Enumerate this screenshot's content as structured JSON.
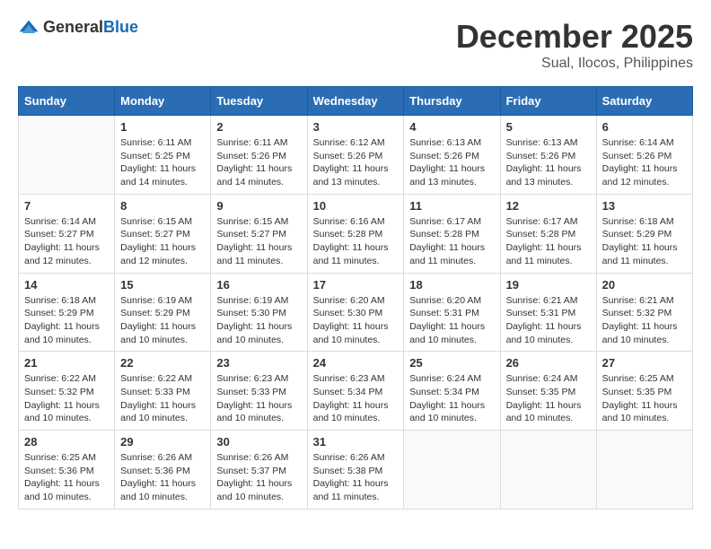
{
  "logo": {
    "general": "General",
    "blue": "Blue"
  },
  "title": "December 2025",
  "location": "Sual, Ilocos, Philippines",
  "weekdays": [
    "Sunday",
    "Monday",
    "Tuesday",
    "Wednesday",
    "Thursday",
    "Friday",
    "Saturday"
  ],
  "weeks": [
    [
      {
        "day": "",
        "empty": true
      },
      {
        "day": "1",
        "sunrise": "Sunrise: 6:11 AM",
        "sunset": "Sunset: 5:25 PM",
        "daylight": "Daylight: 11 hours and 14 minutes."
      },
      {
        "day": "2",
        "sunrise": "Sunrise: 6:11 AM",
        "sunset": "Sunset: 5:26 PM",
        "daylight": "Daylight: 11 hours and 14 minutes."
      },
      {
        "day": "3",
        "sunrise": "Sunrise: 6:12 AM",
        "sunset": "Sunset: 5:26 PM",
        "daylight": "Daylight: 11 hours and 13 minutes."
      },
      {
        "day": "4",
        "sunrise": "Sunrise: 6:13 AM",
        "sunset": "Sunset: 5:26 PM",
        "daylight": "Daylight: 11 hours and 13 minutes."
      },
      {
        "day": "5",
        "sunrise": "Sunrise: 6:13 AM",
        "sunset": "Sunset: 5:26 PM",
        "daylight": "Daylight: 11 hours and 13 minutes."
      },
      {
        "day": "6",
        "sunrise": "Sunrise: 6:14 AM",
        "sunset": "Sunset: 5:26 PM",
        "daylight": "Daylight: 11 hours and 12 minutes."
      }
    ],
    [
      {
        "day": "7",
        "sunrise": "Sunrise: 6:14 AM",
        "sunset": "Sunset: 5:27 PM",
        "daylight": "Daylight: 11 hours and 12 minutes."
      },
      {
        "day": "8",
        "sunrise": "Sunrise: 6:15 AM",
        "sunset": "Sunset: 5:27 PM",
        "daylight": "Daylight: 11 hours and 12 minutes."
      },
      {
        "day": "9",
        "sunrise": "Sunrise: 6:15 AM",
        "sunset": "Sunset: 5:27 PM",
        "daylight": "Daylight: 11 hours and 11 minutes."
      },
      {
        "day": "10",
        "sunrise": "Sunrise: 6:16 AM",
        "sunset": "Sunset: 5:28 PM",
        "daylight": "Daylight: 11 hours and 11 minutes."
      },
      {
        "day": "11",
        "sunrise": "Sunrise: 6:17 AM",
        "sunset": "Sunset: 5:28 PM",
        "daylight": "Daylight: 11 hours and 11 minutes."
      },
      {
        "day": "12",
        "sunrise": "Sunrise: 6:17 AM",
        "sunset": "Sunset: 5:28 PM",
        "daylight": "Daylight: 11 hours and 11 minutes."
      },
      {
        "day": "13",
        "sunrise": "Sunrise: 6:18 AM",
        "sunset": "Sunset: 5:29 PM",
        "daylight": "Daylight: 11 hours and 11 minutes."
      }
    ],
    [
      {
        "day": "14",
        "sunrise": "Sunrise: 6:18 AM",
        "sunset": "Sunset: 5:29 PM",
        "daylight": "Daylight: 11 hours and 10 minutes."
      },
      {
        "day": "15",
        "sunrise": "Sunrise: 6:19 AM",
        "sunset": "Sunset: 5:29 PM",
        "daylight": "Daylight: 11 hours and 10 minutes."
      },
      {
        "day": "16",
        "sunrise": "Sunrise: 6:19 AM",
        "sunset": "Sunset: 5:30 PM",
        "daylight": "Daylight: 11 hours and 10 minutes."
      },
      {
        "day": "17",
        "sunrise": "Sunrise: 6:20 AM",
        "sunset": "Sunset: 5:30 PM",
        "daylight": "Daylight: 11 hours and 10 minutes."
      },
      {
        "day": "18",
        "sunrise": "Sunrise: 6:20 AM",
        "sunset": "Sunset: 5:31 PM",
        "daylight": "Daylight: 11 hours and 10 minutes."
      },
      {
        "day": "19",
        "sunrise": "Sunrise: 6:21 AM",
        "sunset": "Sunset: 5:31 PM",
        "daylight": "Daylight: 11 hours and 10 minutes."
      },
      {
        "day": "20",
        "sunrise": "Sunrise: 6:21 AM",
        "sunset": "Sunset: 5:32 PM",
        "daylight": "Daylight: 11 hours and 10 minutes."
      }
    ],
    [
      {
        "day": "21",
        "sunrise": "Sunrise: 6:22 AM",
        "sunset": "Sunset: 5:32 PM",
        "daylight": "Daylight: 11 hours and 10 minutes."
      },
      {
        "day": "22",
        "sunrise": "Sunrise: 6:22 AM",
        "sunset": "Sunset: 5:33 PM",
        "daylight": "Daylight: 11 hours and 10 minutes."
      },
      {
        "day": "23",
        "sunrise": "Sunrise: 6:23 AM",
        "sunset": "Sunset: 5:33 PM",
        "daylight": "Daylight: 11 hours and 10 minutes."
      },
      {
        "day": "24",
        "sunrise": "Sunrise: 6:23 AM",
        "sunset": "Sunset: 5:34 PM",
        "daylight": "Daylight: 11 hours and 10 minutes."
      },
      {
        "day": "25",
        "sunrise": "Sunrise: 6:24 AM",
        "sunset": "Sunset: 5:34 PM",
        "daylight": "Daylight: 11 hours and 10 minutes."
      },
      {
        "day": "26",
        "sunrise": "Sunrise: 6:24 AM",
        "sunset": "Sunset: 5:35 PM",
        "daylight": "Daylight: 11 hours and 10 minutes."
      },
      {
        "day": "27",
        "sunrise": "Sunrise: 6:25 AM",
        "sunset": "Sunset: 5:35 PM",
        "daylight": "Daylight: 11 hours and 10 minutes."
      }
    ],
    [
      {
        "day": "28",
        "sunrise": "Sunrise: 6:25 AM",
        "sunset": "Sunset: 5:36 PM",
        "daylight": "Daylight: 11 hours and 10 minutes."
      },
      {
        "day": "29",
        "sunrise": "Sunrise: 6:26 AM",
        "sunset": "Sunset: 5:36 PM",
        "daylight": "Daylight: 11 hours and 10 minutes."
      },
      {
        "day": "30",
        "sunrise": "Sunrise: 6:26 AM",
        "sunset": "Sunset: 5:37 PM",
        "daylight": "Daylight: 11 hours and 10 minutes."
      },
      {
        "day": "31",
        "sunrise": "Sunrise: 6:26 AM",
        "sunset": "Sunset: 5:38 PM",
        "daylight": "Daylight: 11 hours and 11 minutes."
      },
      {
        "day": "",
        "empty": true
      },
      {
        "day": "",
        "empty": true
      },
      {
        "day": "",
        "empty": true
      }
    ]
  ]
}
